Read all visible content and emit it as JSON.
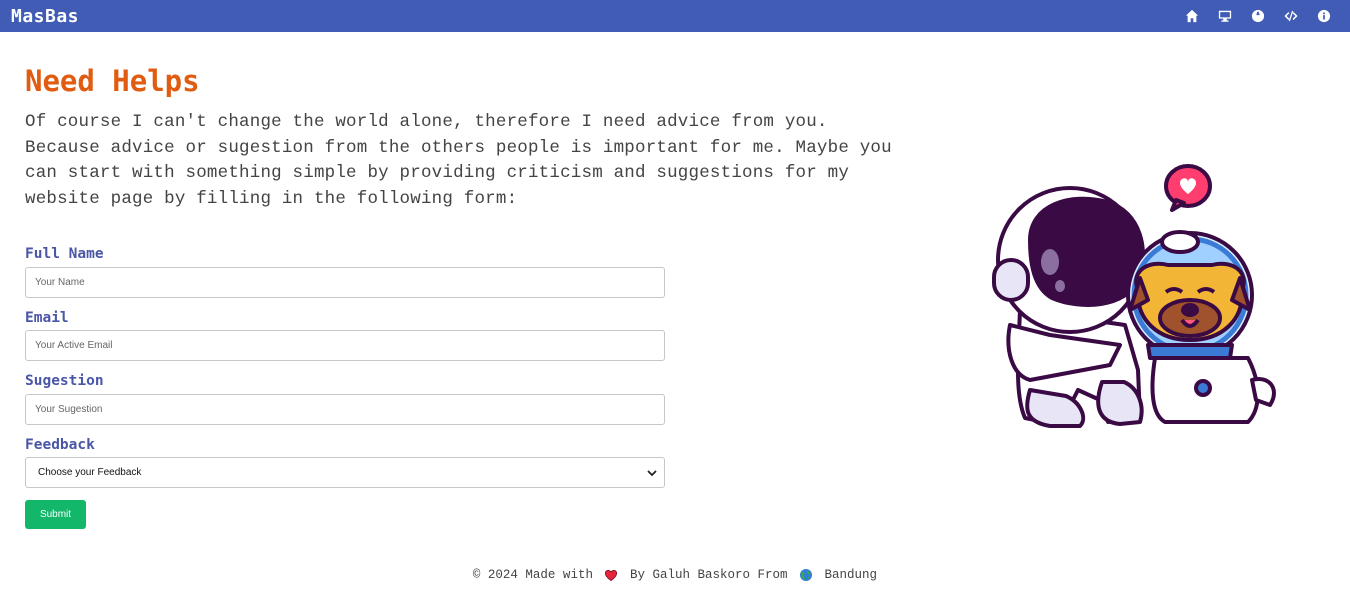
{
  "navbar": {
    "brand": "MasBas",
    "icons": [
      "home-icon",
      "desktop-icon",
      "globe-icon",
      "code-icon",
      "info-icon"
    ]
  },
  "main": {
    "title": "Need Helps",
    "intro": "Of course I can't change the world alone, therefore I need advice from you. Because advice or sugestion from the others people is important for me. Maybe you can start with something simple by providing criticism and suggestions for my website page by filling in the following form:"
  },
  "form": {
    "name_label": "Full Name",
    "name_placeholder": "Your Name",
    "email_label": "Email",
    "email_placeholder": "Your Active Email",
    "suggestion_label": "Sugestion",
    "suggestion_placeholder": "Your Sugestion",
    "feedback_label": "Feedback",
    "feedback_selected": "Choose your Feedback",
    "submit_label": "Submit"
  },
  "footer": {
    "prefix": "© 2024 Made with",
    "middle": "By Galuh Baskoro From",
    "city": "Bandung"
  },
  "colors": {
    "navbar": "#405cb4",
    "title": "#e05c10",
    "label": "#4a56a6",
    "submit": "#12b76a"
  }
}
